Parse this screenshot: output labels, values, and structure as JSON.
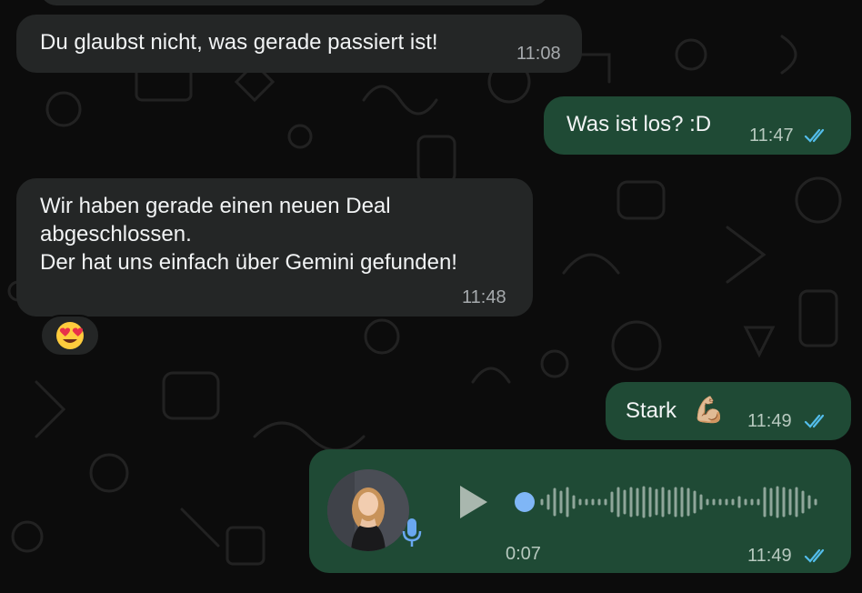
{
  "chat": {
    "messages": [
      {
        "direction": "incoming",
        "text": "Du glaubst nicht, was gerade passiert ist!",
        "time": "11:08"
      },
      {
        "direction": "outgoing",
        "text": "Was ist los? :D",
        "time": "11:47",
        "read": true
      },
      {
        "direction": "incoming",
        "lines": [
          "Wir haben gerade einen neuen Deal",
          "abgeschlossen.",
          "Der hat uns einfach über Gemini gefunden!"
        ],
        "time": "11:48",
        "reaction": "😍"
      },
      {
        "direction": "outgoing",
        "text": "Stark",
        "emoji": "💪🏼",
        "time": "11:49",
        "read": true
      },
      {
        "direction": "outgoing",
        "type": "voice",
        "duration": "0:07",
        "time": "11:49",
        "read": true,
        "progress": 0
      }
    ]
  },
  "colors": {
    "background": "#0c0c0c",
    "incoming_bubble": "#242626",
    "outgoing_bubble": "#1f4a35",
    "read_ticks": "#53bdeb",
    "voice_dot": "#7fb6f6"
  }
}
